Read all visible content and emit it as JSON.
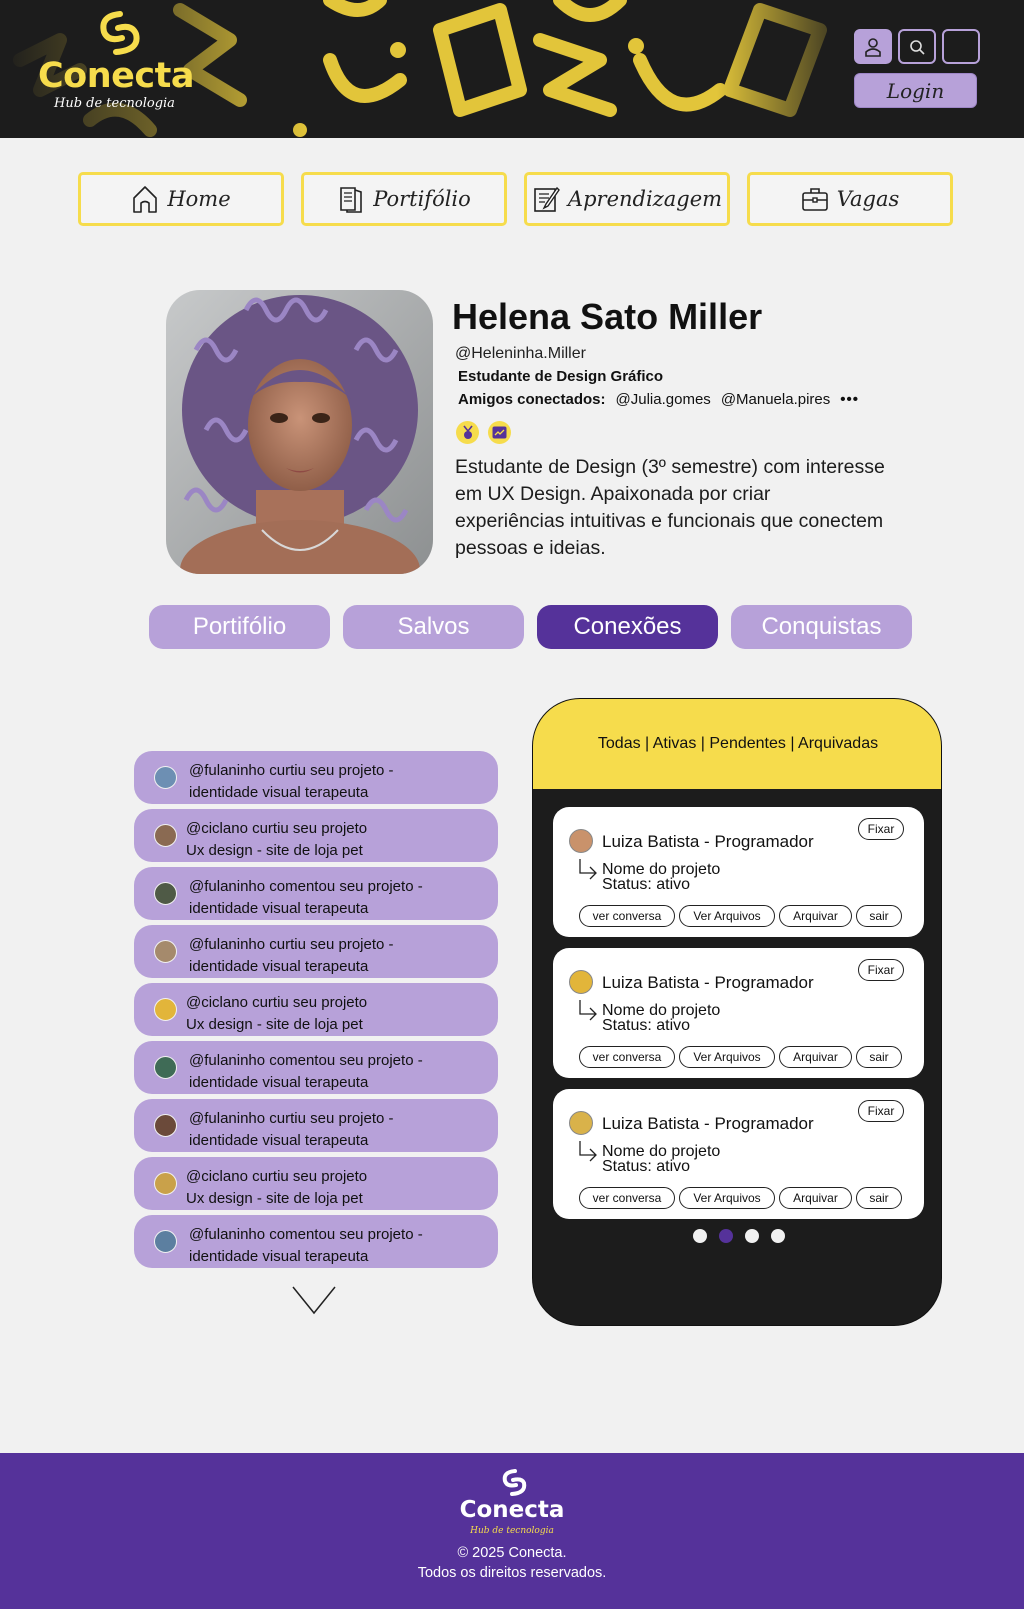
{
  "header": {
    "logo_text": "Conecta",
    "logo_sub": "Hub de tecnologia",
    "login_label": "Login",
    "icons": [
      "user-icon",
      "search-icon",
      "blank-icon"
    ]
  },
  "nav": [
    {
      "label": "Home",
      "icon": "home-icon"
    },
    {
      "label": "Portifólio",
      "icon": "book-icon"
    },
    {
      "label": "Aprendizagem",
      "icon": "notebook-icon"
    },
    {
      "label": "Vagas",
      "icon": "briefcase-icon"
    }
  ],
  "profile": {
    "name": "Helena Sato Miller",
    "handle": "@Heleninha.Miller",
    "role": "Estudante de Design Gráfico",
    "friends_label": "Amigos conectados:",
    "friends": [
      "@Julia.gomes",
      "@Manuela.pires"
    ],
    "more": "•••",
    "bio": "Estudante de Design (3º semestre) com interesse em UX Design. Apaixonada por criar experiências intuitivas e funcionais que conectem pessoas e ideias.",
    "badges": [
      "medal-icon",
      "chart-icon"
    ]
  },
  "tabs": [
    {
      "label": "Portifólio",
      "active": false
    },
    {
      "label": "Salvos",
      "active": false
    },
    {
      "label": "Conexões",
      "active": true
    },
    {
      "label": "Conquistas",
      "active": false
    }
  ],
  "notifications": [
    {
      "text": "@fulaninho curtiu seu projeto -\nidentidade visual terapeuta",
      "avatar_color": "#6d8fb3"
    },
    {
      "text": "@ciclano curtiu seu projeto\nUx design - site de loja pet",
      "avatar_color": "#8a6a52"
    },
    {
      "text": "@fulaninho comentou seu projeto -\nidentidade visual terapeuta",
      "avatar_color": "#4f5a46"
    },
    {
      "text": "@fulaninho curtiu seu projeto -\nidentidade visual terapeuta",
      "avatar_color": "#a58a6c"
    },
    {
      "text": "@ciclano curtiu seu projeto\nUx design - site de loja pet",
      "avatar_color": "#e2b53a"
    },
    {
      "text": "@fulaninho comentou seu projeto -\nidentidade visual terapeuta",
      "avatar_color": "#3f6b56"
    },
    {
      "text": "@fulaninho curtiu seu projeto -\nidentidade visual terapeuta",
      "avatar_color": "#6b4a3a"
    },
    {
      "text": "@ciclano curtiu seu projeto\nUx design - site de loja pet",
      "avatar_color": "#c9a14a"
    },
    {
      "text": "@fulaninho comentou seu projeto -\nidentidade visual terapeuta",
      "avatar_color": "#5c7fa0"
    }
  ],
  "connections": {
    "filter": "Todas | Ativas | Pendentes | Arquivadas",
    "cards": [
      {
        "name": "Luiza Batista - Programador",
        "project": "Nome do projeto",
        "status": "Status: ativo",
        "pin": "Fixar",
        "buttons": [
          "ver conversa",
          "Ver Arquivos",
          "Arquivar",
          "sair"
        ],
        "avatar_color": "#c9926b"
      },
      {
        "name": "Luiza Batista - Programador",
        "project": "Nome do projeto",
        "status": "Status: ativo",
        "pin": "Fixar",
        "buttons": [
          "ver conversa",
          "Ver Arquivos",
          "Arquivar",
          "sair"
        ],
        "avatar_color": "#e2b53a"
      },
      {
        "name": "Luiza Batista - Programador",
        "project": "Nome do projeto",
        "status": "Status: ativo",
        "pin": "Fixar",
        "buttons": [
          "ver conversa",
          "Ver Arquivos",
          "Arquivar",
          "sair"
        ],
        "avatar_color": "#d9b24a"
      }
    ],
    "page_count": 4,
    "active_page": 2
  },
  "footer": {
    "logo_text": "Conecta",
    "logo_sub": "Hub de tecnologia",
    "copyright": "© 2025 Conecta.",
    "rights": "Todos os direitos reservados."
  },
  "colors": {
    "yellow": "#f6dc4c",
    "lilac": "#b7a1d9",
    "purple": "#55329a",
    "dark": "#1c1c1c"
  }
}
